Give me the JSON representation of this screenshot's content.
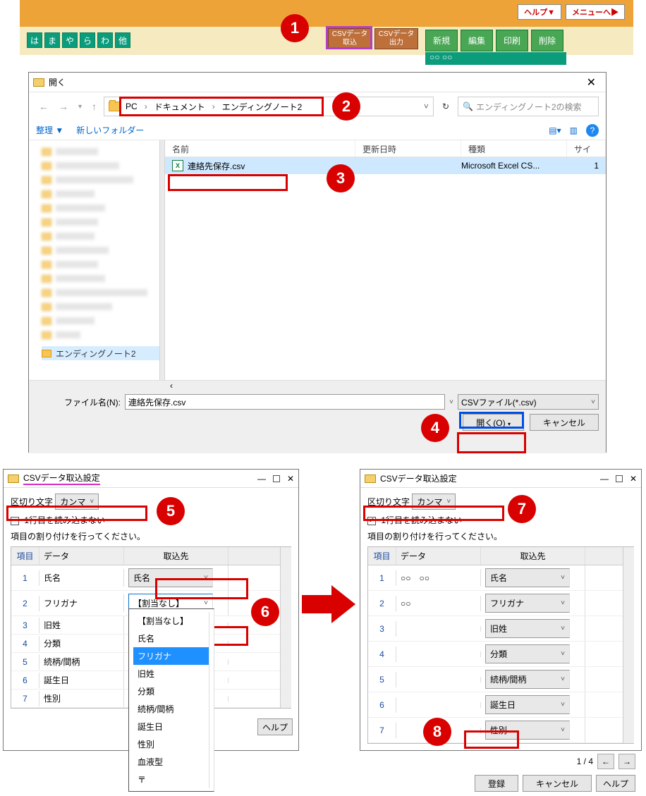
{
  "top": {
    "help": "ヘルプ▼",
    "menu": "メニューへ▶",
    "kana": [
      "は",
      "ま",
      "や",
      "ら",
      "わ",
      "他"
    ],
    "csv_import": "CSVデータ\n取込",
    "csv_export": "CSVデータ\n出力",
    "btn_new": "新規",
    "btn_edit": "編集",
    "btn_print": "印刷",
    "btn_del": "削除",
    "circles": "○○ ○○"
  },
  "openDlg": {
    "title": "開く",
    "crumbs": [
      "PC",
      "ドキュメント",
      "エンディングノート2"
    ],
    "search_ph": "エンディングノート2の検索",
    "organize": "整理 ▼",
    "newfolder": "新しいフォルダー",
    "cols": {
      "name": "名前",
      "date": "更新日時",
      "type": "種類",
      "size": "サイズ"
    },
    "file_name": "連絡先保存.csv",
    "file_type": "Microsoft Excel CS...",
    "file_size": "1",
    "tree_selected": "エンディングノート2",
    "fnlabel": "ファイル名(N):",
    "fnvalue": "連絡先保存.csv",
    "filter": "CSVファイル(*.csv)",
    "open": "開く(O)",
    "cancel": "キャンセル"
  },
  "cfg": {
    "title": "CSVデータ取込設定",
    "delim_label": "区切り文字",
    "delim_value": "カンマ",
    "skip_first": "1行目を読み込まない",
    "assign_msg": "項目の割り付けを行ってください。",
    "hdr": {
      "c1": "項目",
      "c2": "データ",
      "c3": "取込先"
    },
    "left_rows": [
      {
        "n": "1",
        "d": "氏名",
        "t": "氏名"
      },
      {
        "n": "2",
        "d": "フリガナ",
        "t": "【割当なし】"
      },
      {
        "n": "3",
        "d": "旧姓",
        "t": ""
      },
      {
        "n": "4",
        "d": "分類",
        "t": ""
      },
      {
        "n": "5",
        "d": "続柄/間柄",
        "t": ""
      },
      {
        "n": "6",
        "d": "誕生日",
        "t": ""
      },
      {
        "n": "7",
        "d": "性別",
        "t": ""
      }
    ],
    "dd_options": [
      "【割当なし】",
      "氏名",
      "フリガナ",
      "旧姓",
      "分類",
      "続柄/間柄",
      "誕生日",
      "性別",
      "血液型",
      "〒"
    ],
    "dd_selected": "フリガナ",
    "right_rows": [
      {
        "n": "1",
        "d": "○○　○○",
        "t": "氏名"
      },
      {
        "n": "2",
        "d": "○○",
        "t": "フリガナ"
      },
      {
        "n": "3",
        "d": "",
        "t": "旧姓"
      },
      {
        "n": "4",
        "d": "",
        "t": "分類"
      },
      {
        "n": "5",
        "d": "",
        "t": "続柄/間柄"
      },
      {
        "n": "6",
        "d": "",
        "t": "誕生日"
      },
      {
        "n": "7",
        "d": "",
        "t": "性別"
      }
    ],
    "page": "1 / 4",
    "register": "登録",
    "cancel": "キャンセル",
    "help": "ヘルプ"
  }
}
